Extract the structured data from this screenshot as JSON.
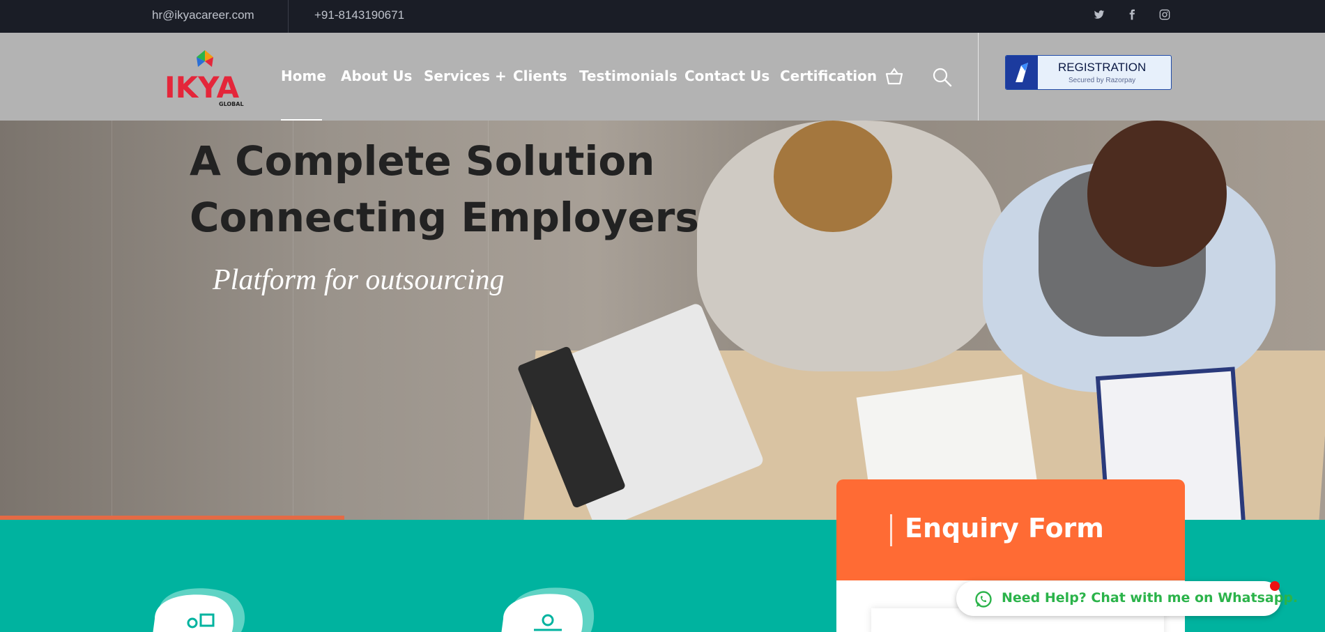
{
  "topbar": {
    "email": "hr@ikyacareer.com",
    "phone": "+91-8143190671",
    "social": [
      "twitter-icon",
      "facebook-icon",
      "instagram-icon"
    ]
  },
  "header": {
    "logo_text": "IKYA",
    "logo_sub": "GLOBAL",
    "nav": [
      {
        "label": "Home",
        "active": true
      },
      {
        "label": "About Us"
      },
      {
        "label": "Services +"
      },
      {
        "label": "Clients"
      },
      {
        "label": "Testimonials"
      },
      {
        "label": "Contact Us"
      },
      {
        "label": "Certification"
      }
    ],
    "icons": [
      "cart-icon",
      "search-icon"
    ],
    "registration": {
      "title": "REGISTRATION",
      "subtitle": "Secured by Razorpay"
    }
  },
  "hero": {
    "headline_line1": "A Complete Solution",
    "headline_line2": "Connecting Employers",
    "tagline": "Platform for outsourcing",
    "slide_progress": 0.26
  },
  "enquiry": {
    "title": "Enquiry Form"
  },
  "whatsapp": {
    "label": "Need Help? Chat with me on Whatsapp."
  },
  "colors": {
    "topbar_bg": "#1a1d26",
    "header_bg": "#b3b3b3",
    "teal": "#00b39f",
    "orange": "#ff6b34",
    "whatsapp_green": "#2bb34a",
    "brand_red": "#e4263a"
  }
}
